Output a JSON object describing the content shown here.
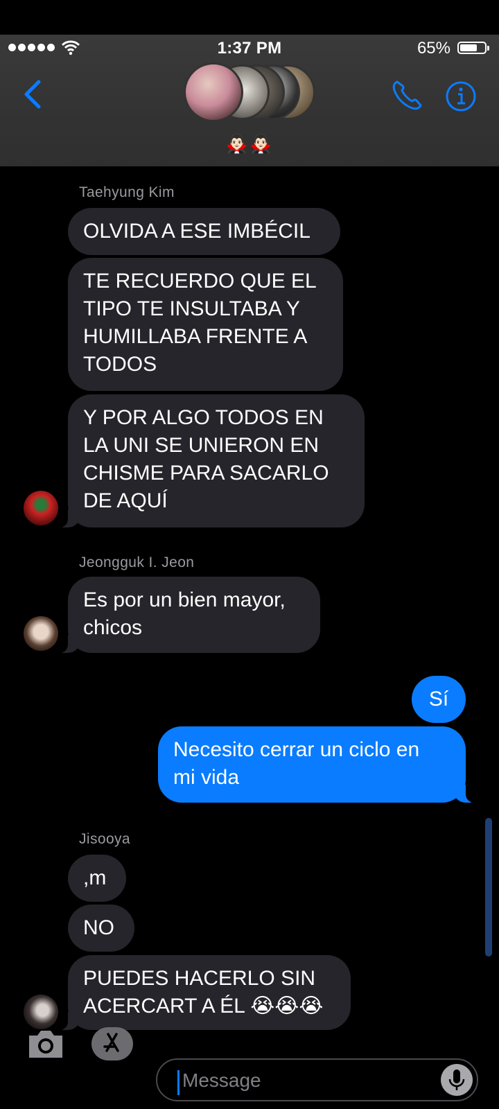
{
  "status_bar": {
    "time": "1:37 PM",
    "battery": "65%"
  },
  "header": {
    "group_name": "🧛🏻‍♂️🧛🏻‍♂️"
  },
  "messages": {
    "taehyung": {
      "sender": "Taehyung Kim",
      "m1": "OLVIDA A ESE IMBÉCIL",
      "m2": "TE RECUERDO QUE EL\nTIPO TE INSULTABA Y\nHUMILLABA FRENTE A\nTODOS",
      "m3": "Y POR ALGO TODOS EN\nLA UNI SE UNIERON EN\nCHISME PARA SACARLO\nDE AQUÍ"
    },
    "jeongguk": {
      "sender": "Jeongguk I. Jeon",
      "m1": "Es por un bien mayor,\nchicos"
    },
    "me": {
      "m1": "Sí",
      "m2": "Necesito cerrar un ciclo en\nmi vida"
    },
    "jisooya": {
      "sender": "Jisooya",
      "m1": ",m",
      "m2": "NO",
      "m3": "PUEDES HACERLO SIN\nACERCART A ÉL 😭😭😭"
    }
  },
  "composer": {
    "placeholder": "Message"
  },
  "colors": {
    "accent": "#0a7cff",
    "bubble_in": "#26252b",
    "header_bg": "#333333"
  }
}
